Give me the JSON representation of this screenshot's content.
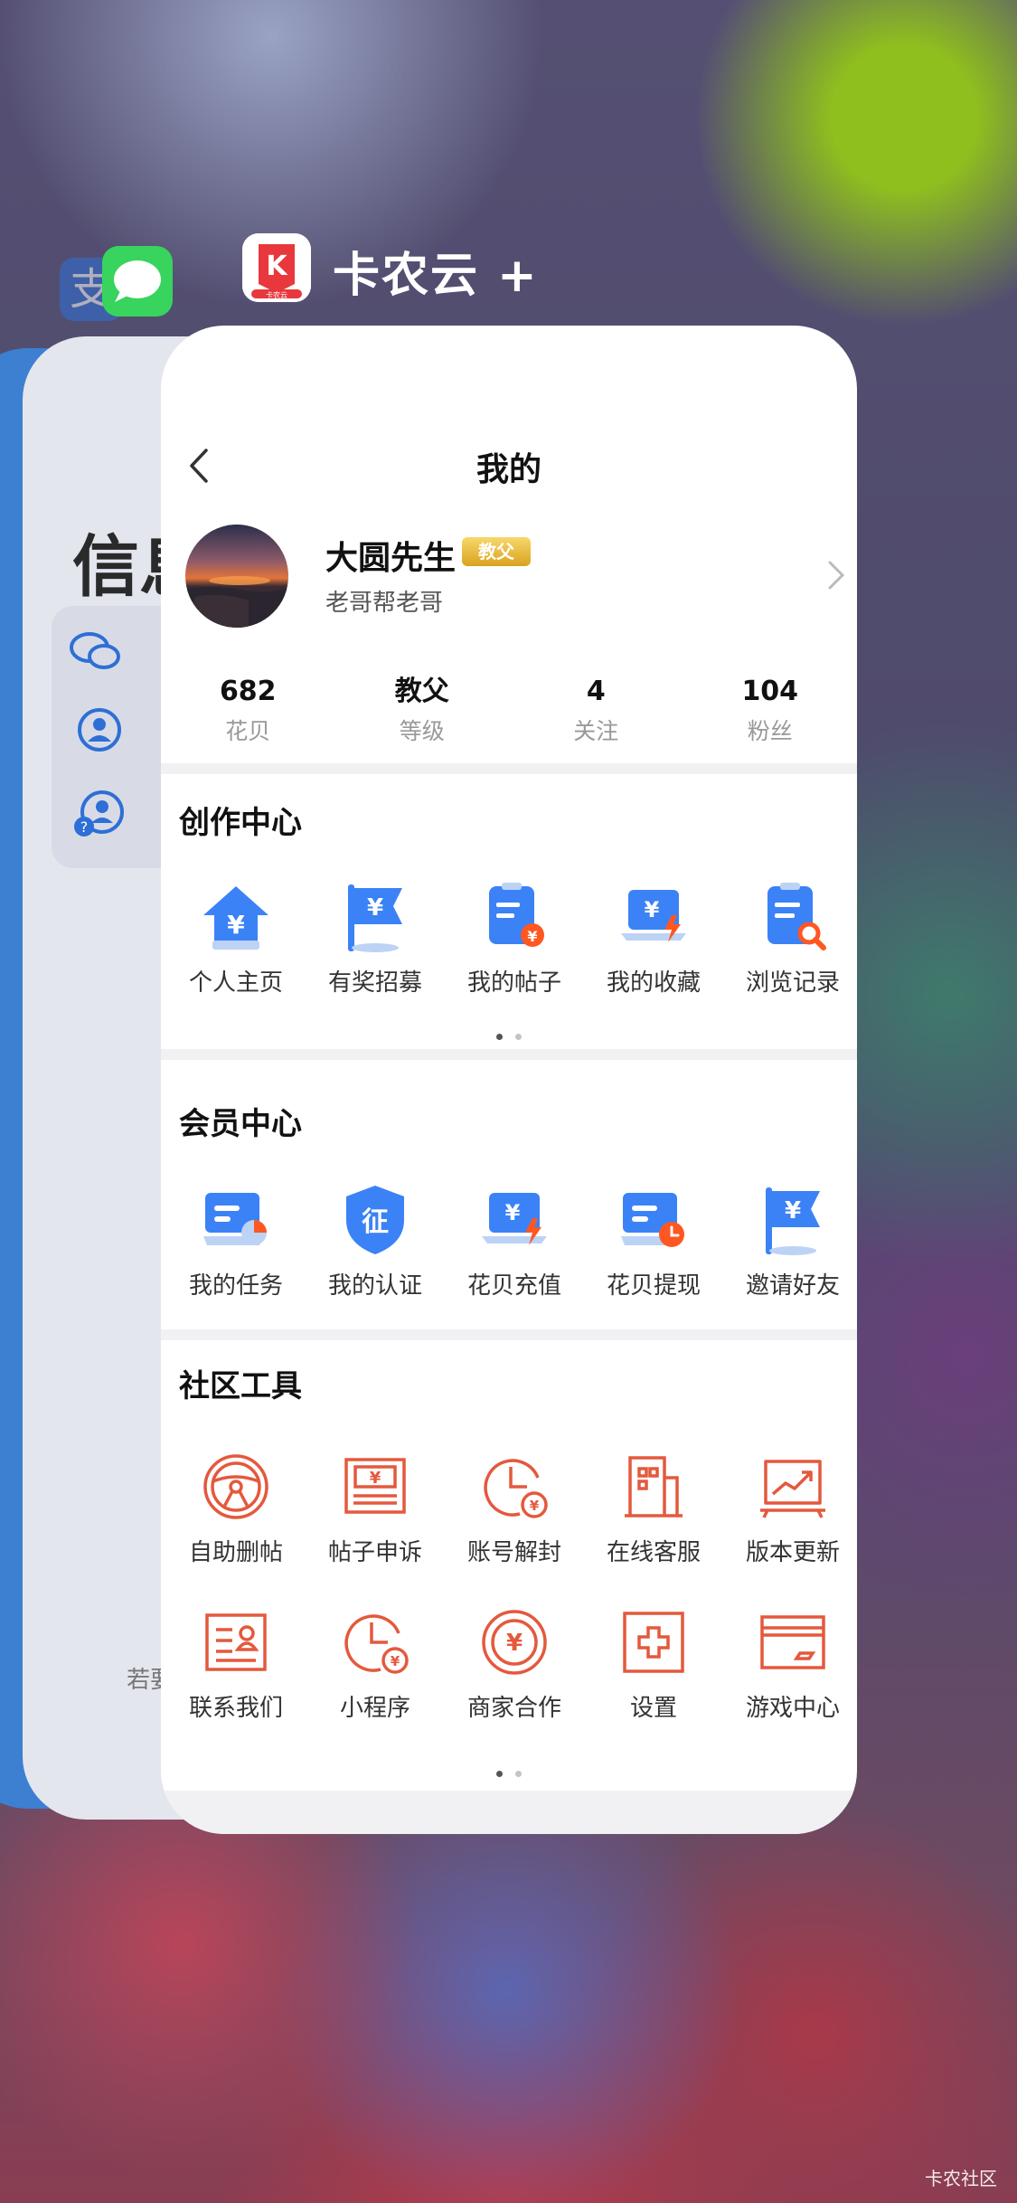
{
  "switcher": {
    "app_name": "卡农云",
    "app_name_suffix": "+",
    "behind_card_title": "信息",
    "behind_card_footer": "若要",
    "alipay_glyph": "支",
    "app_icon_caption": "卡农云"
  },
  "nav": {
    "title": "我的"
  },
  "profile": {
    "name": "大圆先生",
    "badge": "教父",
    "subtitle": "老哥帮老哥"
  },
  "stats": [
    {
      "value": "682",
      "label": "花贝"
    },
    {
      "value": "教父",
      "label": "等级"
    },
    {
      "value": "4",
      "label": "关注"
    },
    {
      "value": "104",
      "label": "粉丝"
    }
  ],
  "sections": {
    "creation": {
      "title": "创作中心",
      "items": [
        {
          "label": "个人主页",
          "icon": "house-yen-icon"
        },
        {
          "label": "有奖招募",
          "icon": "flag-yen-icon"
        },
        {
          "label": "我的帖子",
          "icon": "clipboard-yen-icon"
        },
        {
          "label": "我的收藏",
          "icon": "laptop-yen-icon"
        },
        {
          "label": "浏览记录",
          "icon": "clipboard-search-icon"
        }
      ]
    },
    "member": {
      "title": "会员中心",
      "items": [
        {
          "label": "我的任务",
          "icon": "card-pie-icon"
        },
        {
          "label": "我的认证",
          "icon": "shield-cert-icon"
        },
        {
          "label": "花贝充值",
          "icon": "laptop-bolt-icon"
        },
        {
          "label": "花贝提现",
          "icon": "card-clock-icon"
        },
        {
          "label": "邀请好友",
          "icon": "flag-yen-icon"
        }
      ]
    },
    "tools": {
      "title": "社区工具",
      "row1": [
        {
          "label": "自助删帖",
          "icon": "steering-wheel-icon"
        },
        {
          "label": "帖子申诉",
          "icon": "banknote-icon"
        },
        {
          "label": "账号解封",
          "icon": "clock-yen-icon"
        },
        {
          "label": "在线客服",
          "icon": "building-icon"
        },
        {
          "label": "版本更新",
          "icon": "chart-up-icon"
        }
      ],
      "row2": [
        {
          "label": "联系我们",
          "icon": "contact-card-icon"
        },
        {
          "label": "小程序",
          "icon": "clock-yen-icon"
        },
        {
          "label": "商家合作",
          "icon": "coin-yen-icon"
        },
        {
          "label": "设置",
          "icon": "plus-box-icon"
        },
        {
          "label": "游戏中心",
          "icon": "credit-card-icon"
        }
      ]
    }
  },
  "colors": {
    "blue": "#3b82f6",
    "orange": "#ff5722",
    "tool_red": "#e4593d"
  },
  "watermark": "卡农社区"
}
